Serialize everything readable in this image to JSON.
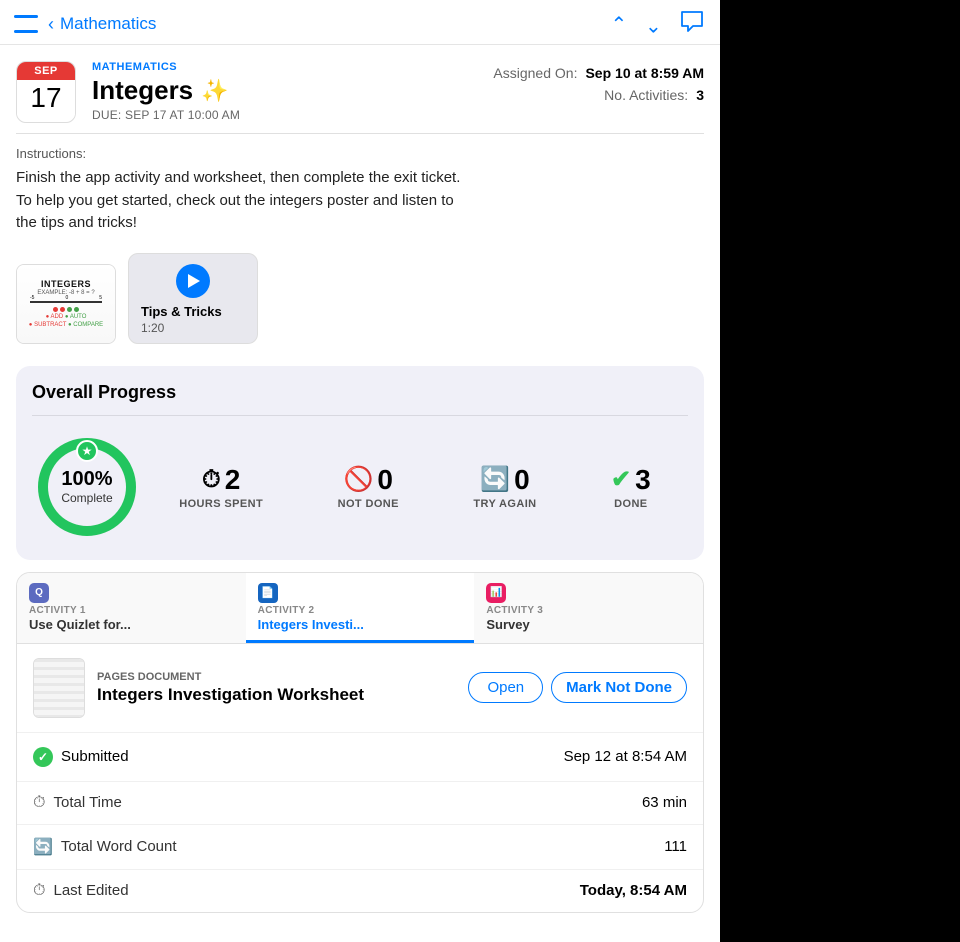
{
  "nav": {
    "back_label": "Mathematics",
    "up_icon": "chevron-up",
    "down_icon": "chevron-down",
    "comment_icon": "comment-bubble"
  },
  "assignment": {
    "calendar": {
      "month": "SEP",
      "day": "17"
    },
    "subject": "MATHEMATICS",
    "title": "Integers",
    "sparkle": "✨",
    "due": "DUE: SEP 17 AT 10:00 AM",
    "assigned_on_label": "Assigned On:",
    "assigned_on_value": "Sep 10 at 8:59 AM",
    "activities_label": "No. Activities:",
    "activities_count": "3"
  },
  "instructions": {
    "heading": "Instructions:",
    "text": "Finish the app activity and worksheet, then complete the exit ticket.\nTo help you get started, check out the integers poster and listen to\nthe tips and tricks!"
  },
  "attachments": {
    "poster_title": "INTEGERS",
    "video_title": "Tips & Tricks",
    "video_duration": "1:20"
  },
  "progress": {
    "title": "Overall Progress",
    "percent": "100%",
    "complete_label": "Complete",
    "hours": "2",
    "hours_label": "HOURS SPENT",
    "not_done": "0",
    "not_done_label": "NOT DONE",
    "try_again": "0",
    "try_again_label": "TRY AGAIN",
    "done": "3",
    "done_label": "DONE"
  },
  "activities": {
    "tabs": [
      {
        "number": "ACTIVITY 1",
        "label": "Use Quizlet for...",
        "active": false,
        "icon_color": "#5c6bc0"
      },
      {
        "number": "ACTIVITY 2",
        "label": "Integers Investi...",
        "active": true,
        "icon_color": "#1565c0"
      },
      {
        "number": "ACTIVITY 3",
        "label": "Survey",
        "active": false,
        "icon_color": "#e91e63"
      }
    ],
    "current": {
      "file_type": "PAGES DOCUMENT",
      "file_name": "Integers Investigation Worksheet",
      "open_label": "Open",
      "mark_label": "Mark Not Done",
      "submitted_label": "Submitted",
      "submitted_date": "Sep 12 at 8:54 AM",
      "total_time_label": "Total Time",
      "total_time_value": "63 min",
      "word_count_label": "Total Word Count",
      "word_count_value": "111",
      "last_edited_label": "Last Edited",
      "last_edited_value": "Today, 8:54 AM"
    }
  }
}
